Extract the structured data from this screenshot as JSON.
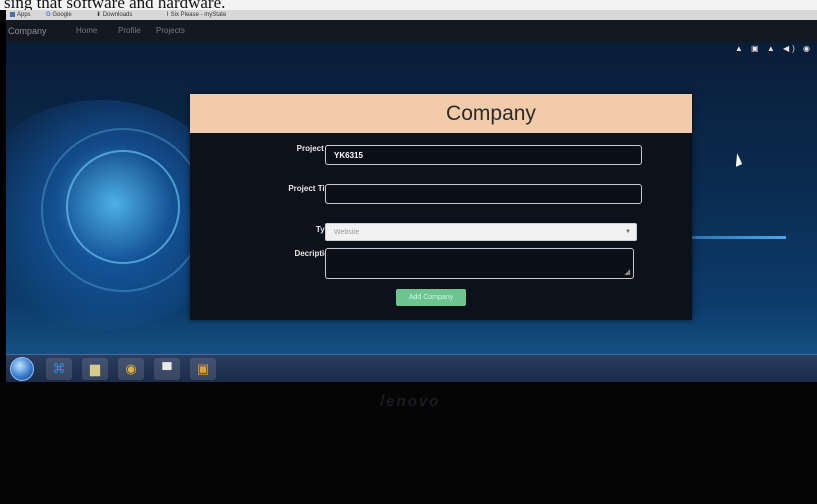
{
  "document": {
    "fragment": "sing that software and hardware."
  },
  "browser": {
    "bookmarks": [
      {
        "name": "bookmark-apps",
        "label": "Apps",
        "icon": "apps-grid-icon"
      },
      {
        "name": "bookmark-google",
        "label": "Google",
        "icon": "google-icon"
      },
      {
        "name": "bookmark-downloads",
        "label": "Downloads",
        "icon": "download-icon"
      },
      {
        "name": "bookmark-mystate",
        "label": "Six Please - myState",
        "icon": "link-icon"
      }
    ]
  },
  "navbar": {
    "brand": "Company",
    "links": [
      "Home",
      "Profile",
      "Projects"
    ]
  },
  "form": {
    "title": "Company",
    "project_id_label": "Project ID",
    "project_id_value": "YK6315",
    "project_title_label": "Project Title",
    "project_title_value": "",
    "type_label": "Type",
    "type_value": "Website",
    "description_label": "Decription",
    "description_value": "",
    "submit_label": "Add Company",
    "colors": {
      "header_bg": "#f2ccaa",
      "card_bg": "#0c111b",
      "button_bg": "#6cc48e"
    }
  },
  "taskbar": {
    "apps": [
      {
        "name": "vscode-taskbar-icon",
        "glyph": "⌘",
        "color": "#2d8fe0"
      },
      {
        "name": "file-explorer-taskbar-icon",
        "glyph": "▆",
        "color": "#d9c98a"
      },
      {
        "name": "chrome-taskbar-icon",
        "glyph": "◉",
        "color": "#e0b040"
      },
      {
        "name": "window-taskbar-icon",
        "glyph": "▀",
        "color": "#e8e8e8"
      },
      {
        "name": "app-taskbar-icon",
        "glyph": "▣",
        "color": "#e89a3a"
      }
    ],
    "tray": "▲ ▣ ▲ ◀) ◉"
  },
  "laptop": {
    "brand": "lenovo"
  }
}
